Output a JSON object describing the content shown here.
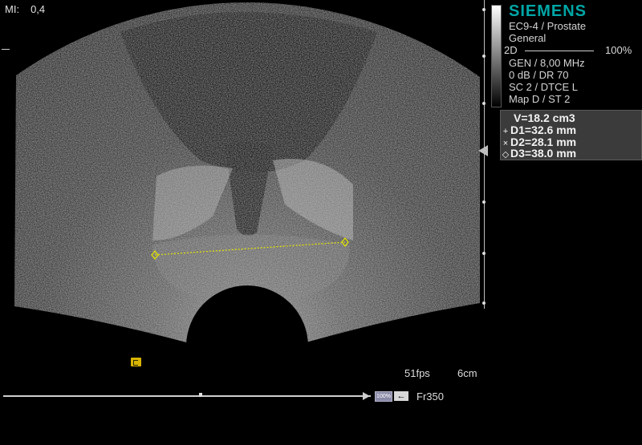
{
  "header": {
    "mi_label": "MI:",
    "mi_value": "0,4"
  },
  "info_panel": {
    "brand": "SIEMENS",
    "probe": "EC9-4 / Prostate",
    "preset": "General",
    "mode": "2D",
    "power": "100%",
    "frequency": "GEN / 8,00 MHz",
    "gain": "0 dB / DR 70",
    "compounding": "SC 2 / DTCE L",
    "map": "Map D / ST 2"
  },
  "measurements": {
    "volume": "V=18.2 cm3",
    "d1": "D1=32.6 mm",
    "d2": "D2=28.1 mm",
    "d3": "D3=38.0 mm",
    "d1_symbol": "+",
    "d2_symbol": "×",
    "d3_symbol": "◇",
    "caliper_color": "#e6e600"
  },
  "footer": {
    "fps": "51fps",
    "depth": "6cm",
    "zoom_badge": "100%",
    "back_arrow": "←",
    "frame": "Fr350"
  },
  "icons": {
    "probe_orientation": "probe-orientation-icon",
    "focus": "focus-marker-icon",
    "play": "cine-play-icon",
    "back": "back-arrow-icon"
  },
  "colors": {
    "brand": "#00a6a6",
    "measurement_box": "#3b3b3b",
    "probe_icon": "#d8b400"
  }
}
